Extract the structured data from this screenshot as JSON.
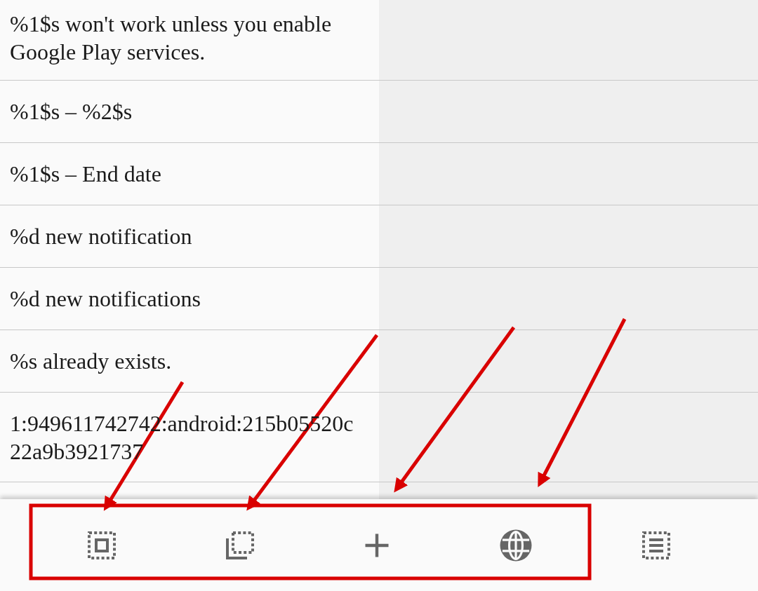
{
  "rows": [
    {
      "text": "%1$s won't work unless you enable Google Play services."
    },
    {
      "text": "%1$s  –  %2$s"
    },
    {
      "text": "%1$s  –  End date"
    },
    {
      "text": "%d new notification"
    },
    {
      "text": "%d new notifications"
    },
    {
      "text": "%s already exists."
    },
    {
      "text": "1:949611742742:android:215b05520c22a9b3921737"
    }
  ],
  "toolbar": [
    {
      "kind": "select-all"
    },
    {
      "kind": "copy"
    },
    {
      "kind": "add"
    },
    {
      "kind": "globe"
    },
    {
      "kind": "list"
    }
  ]
}
